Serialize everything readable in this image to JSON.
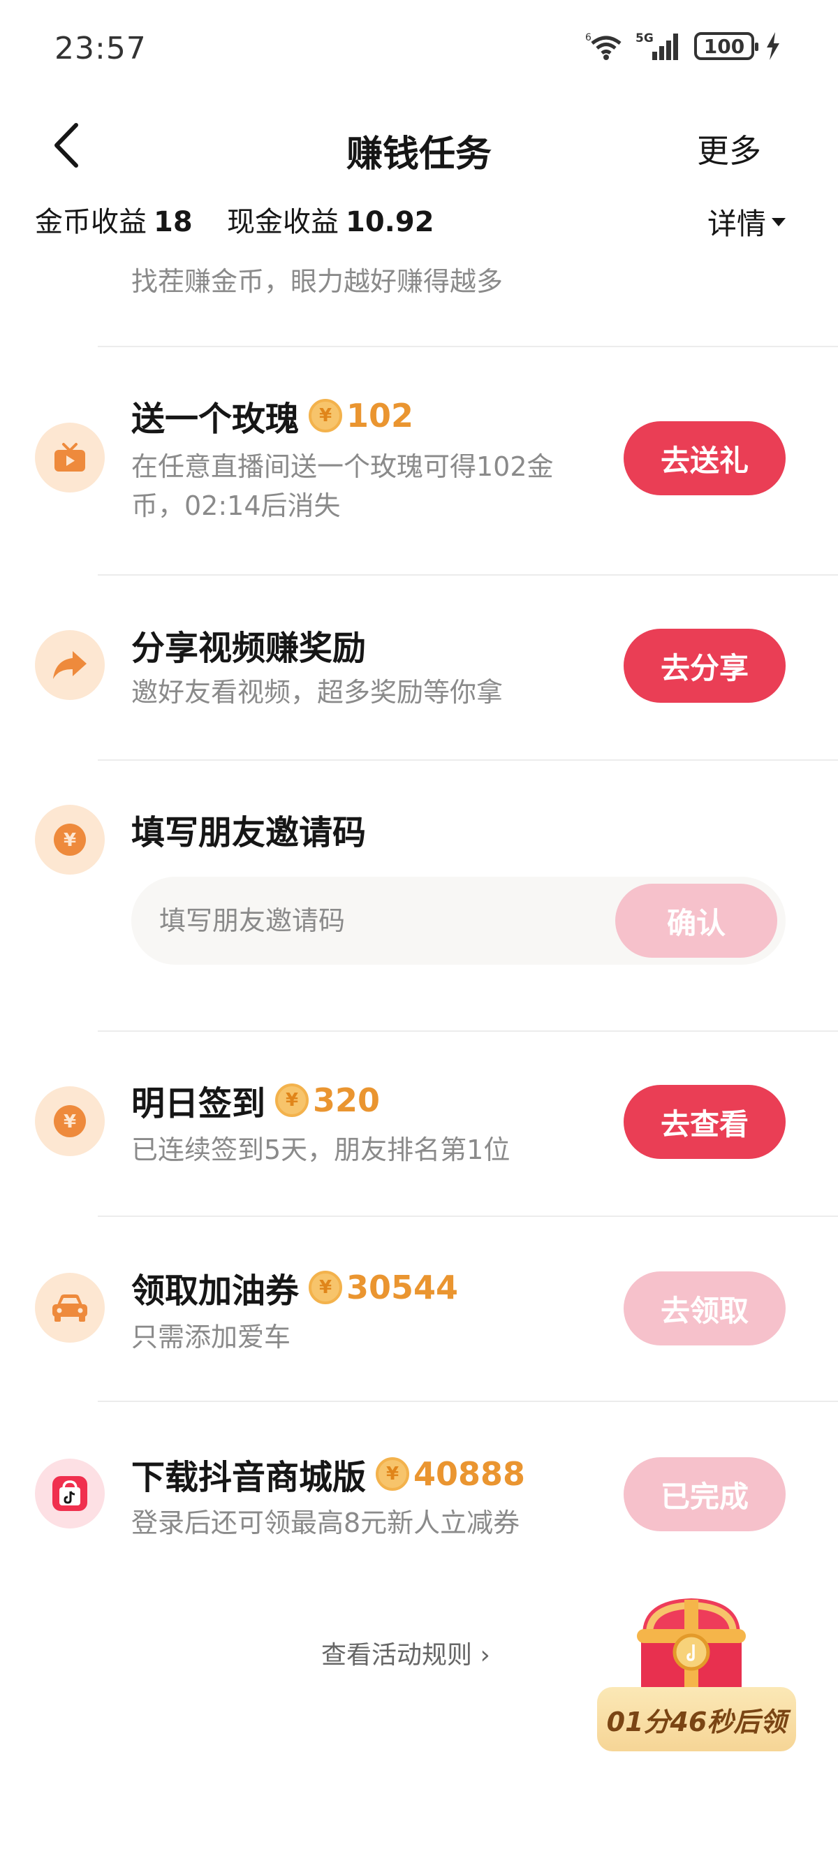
{
  "status_bar": {
    "time": "23:57",
    "battery": "100"
  },
  "nav": {
    "title": "赚钱任务",
    "more": "更多"
  },
  "earnings": {
    "coin_label": "金币收益",
    "coin_value": "18",
    "cash_label": "现金收益",
    "cash_value": "10.92",
    "detail_label": "详情"
  },
  "partial_task": {
    "subtitle": "找茬赚金币，眼力越好赚得越多"
  },
  "tasks": [
    {
      "title": "送一个玫瑰",
      "reward": "102",
      "desc_line1": "在任意直播间送一个玫瑰可得102金",
      "desc_line2": "币，02:14后消失",
      "button": "去送礼",
      "icon": "tv-icon"
    },
    {
      "title": "分享视频赚奖励",
      "desc": "邀好友看视频，超多奖励等你拿",
      "button": "去分享",
      "icon": "share-arrow-icon"
    },
    {
      "title": "填写朋友邀请码",
      "input_placeholder": "填写朋友邀请码",
      "button": "确认",
      "icon": "yuan-coin-icon"
    },
    {
      "title": "明日签到",
      "reward": "320",
      "desc": "已连续签到5天，朋友排名第1位",
      "button": "去查看",
      "icon": "yuan-coin-icon"
    },
    {
      "title": "领取加油券",
      "reward": "30544",
      "desc": "只需添加爱车",
      "button": "去领取",
      "icon": "car-icon"
    },
    {
      "title": "下载抖音商城版",
      "reward": "40888",
      "desc": "登录后还可领最高8元新人立减券",
      "button": "已完成",
      "icon": "shopping-bag-icon"
    }
  ],
  "footer": {
    "rules_link": "查看活动规则 ›",
    "chest_timer": "01分46秒后领"
  },
  "colors": {
    "accent": "#ea3e55",
    "accent_disabled": "#f6c1cb",
    "reward": "#ea9530",
    "icon_bg": "#fde7d2"
  }
}
